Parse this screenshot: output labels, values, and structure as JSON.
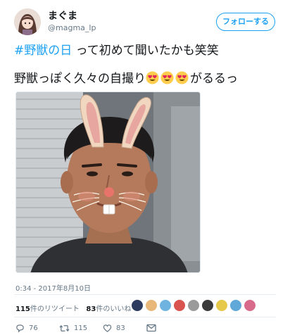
{
  "user": {
    "display_name": "まぐま",
    "handle": "@magma_lp",
    "follow_label": "フォローする"
  },
  "tweet": {
    "hashtag": "#野獣の日",
    "line1_rest": " って初めて聞いたかも笑笑",
    "line2_start": "野獣っぽく久々の自撮り",
    "line2_end": "がるるっ",
    "emoji_names": [
      "heart-eyes-emoji",
      "heart-eyes-emoji",
      "heart-eyes-emoji"
    ],
    "timestamp": "0:34 - 2017年8月10日"
  },
  "stats": {
    "retweets_count": "115",
    "retweets_label": "件のリツイート",
    "likes_count": "83",
    "likes_label": "件のいいね"
  },
  "actions": {
    "reply_count": "76",
    "retweet_count": "115",
    "like_count": "83"
  },
  "colors": {
    "accent": "#1da1f2",
    "muted": "#657786"
  }
}
